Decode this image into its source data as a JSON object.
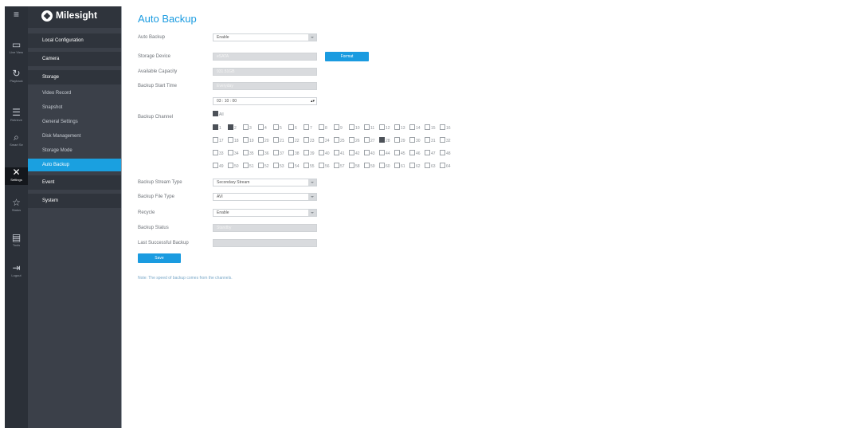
{
  "nav_icons": [
    {
      "name": "menu-icon",
      "glyph": "≡",
      "label": ""
    },
    {
      "name": "live-view-icon",
      "glyph": "▭",
      "label": "Live View"
    },
    {
      "name": "playback-icon",
      "glyph": "↻",
      "label": "Playback"
    },
    {
      "name": "retrieve-icon",
      "glyph": "☰",
      "label": "Retrieve"
    },
    {
      "name": "smart-search-icon",
      "glyph": "⌕",
      "label": "Smart Se"
    },
    {
      "name": "settings-icon",
      "glyph": "✕",
      "label": "Settings"
    },
    {
      "name": "status-icon",
      "glyph": "☆",
      "label": "Status"
    },
    {
      "name": "tools-icon",
      "glyph": "▤",
      "label": "Tools"
    },
    {
      "name": "logout-icon",
      "glyph": "⇥",
      "label": "Logout"
    }
  ],
  "brand": {
    "name": "Milesight"
  },
  "menu": {
    "local_configuration": "Local Configuration",
    "camera": "Camera",
    "storage": "Storage",
    "video_record": "Video Record",
    "snapshot": "Snapshot",
    "general_settings": "General Settings",
    "disk_management": "Disk Management",
    "storage_mode": "Storage Mode",
    "auto_backup": "Auto Backup",
    "event": "Event",
    "system": "System"
  },
  "page": {
    "title": "Auto Backup"
  },
  "form": {
    "auto_backup_label": "Auto Backup",
    "auto_backup_value": "Enable",
    "storage_device_label": "Storage Device",
    "storage_device_value": "eSATA",
    "format_button": "Format",
    "available_capacity_label": "Available Capacity",
    "available_capacity_value": "931.51GB",
    "backup_start_time_label": "Backup Start Time",
    "backup_start_day": "Everyday",
    "backup_start_time": "03 : 10 : 00",
    "backup_channel_label": "Backup Channel",
    "backup_channel_all": "All",
    "backup_stream_type_label": "Backup Stream Type",
    "backup_stream_type_value": "Secondary Stream",
    "backup_file_type_label": "Backup File Type",
    "backup_file_type_value": "AVI",
    "recycle_label": "Recycle",
    "recycle_value": "Enable",
    "backup_status_label": "Backup Status",
    "backup_status_value": "Standby",
    "last_successful_backup_label": "Last Successful Backup",
    "last_successful_backup_value": "",
    "save_button": "Save",
    "note": "Note: The speed of backup comes from the channels."
  },
  "channels_checked": [
    1,
    2,
    28
  ],
  "colors": {
    "accent": "#1a9be0",
    "sidebar": "#3b4049",
    "iconbar": "#2b3038"
  }
}
